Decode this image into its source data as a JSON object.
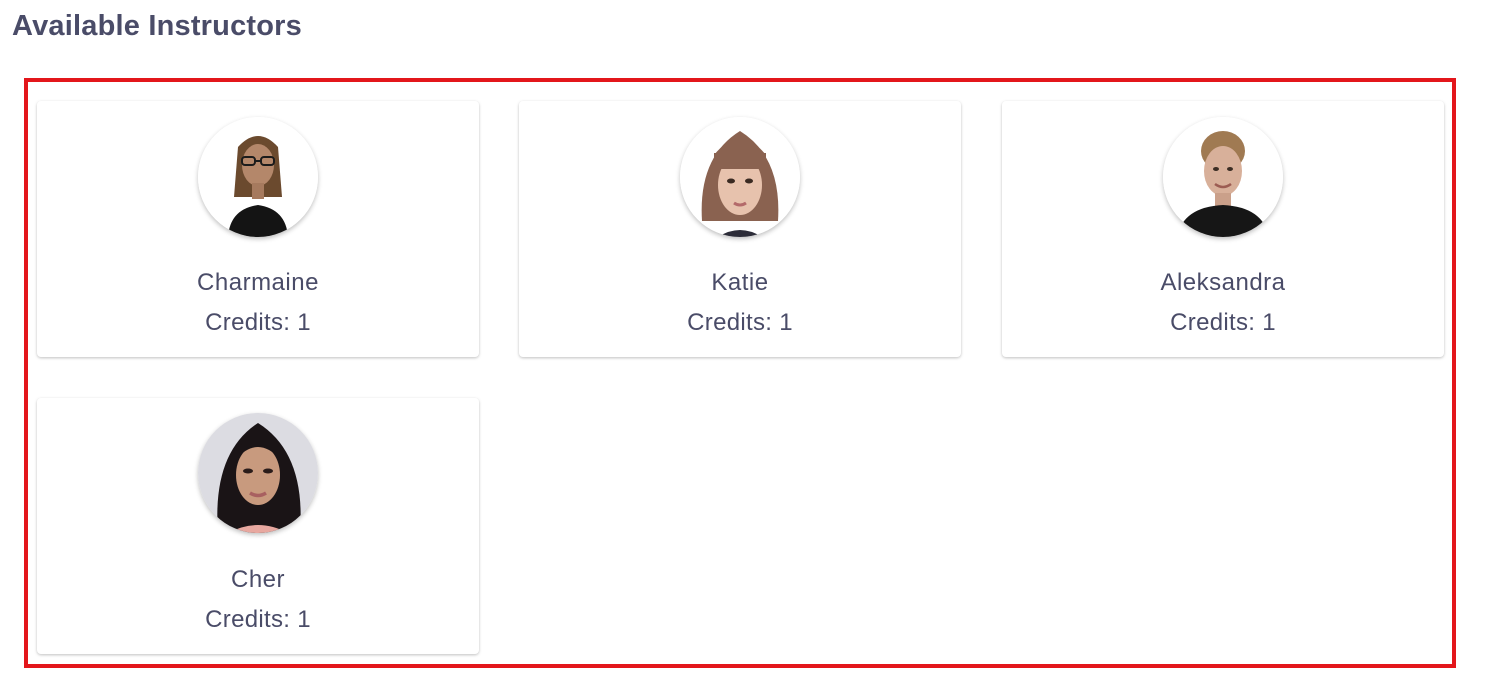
{
  "page": {
    "title": "Available Instructors"
  },
  "instructors": [
    {
      "name": "Charmaine",
      "credits_label": "Credits: 1",
      "photo": "avatar-photo-charmaine"
    },
    {
      "name": "Katie",
      "credits_label": "Credits: 1",
      "photo": "avatar-photo-katie"
    },
    {
      "name": "Aleksandra",
      "credits_label": "Credits: 1",
      "photo": "avatar-photo-aleksandra"
    },
    {
      "name": "Cher",
      "credits_label": "Credits: 1",
      "photo": "avatar-photo-cher"
    }
  ],
  "colors": {
    "text": "#4a4c68",
    "highlight_border": "#e3161b",
    "card_background": "#ffffff"
  }
}
